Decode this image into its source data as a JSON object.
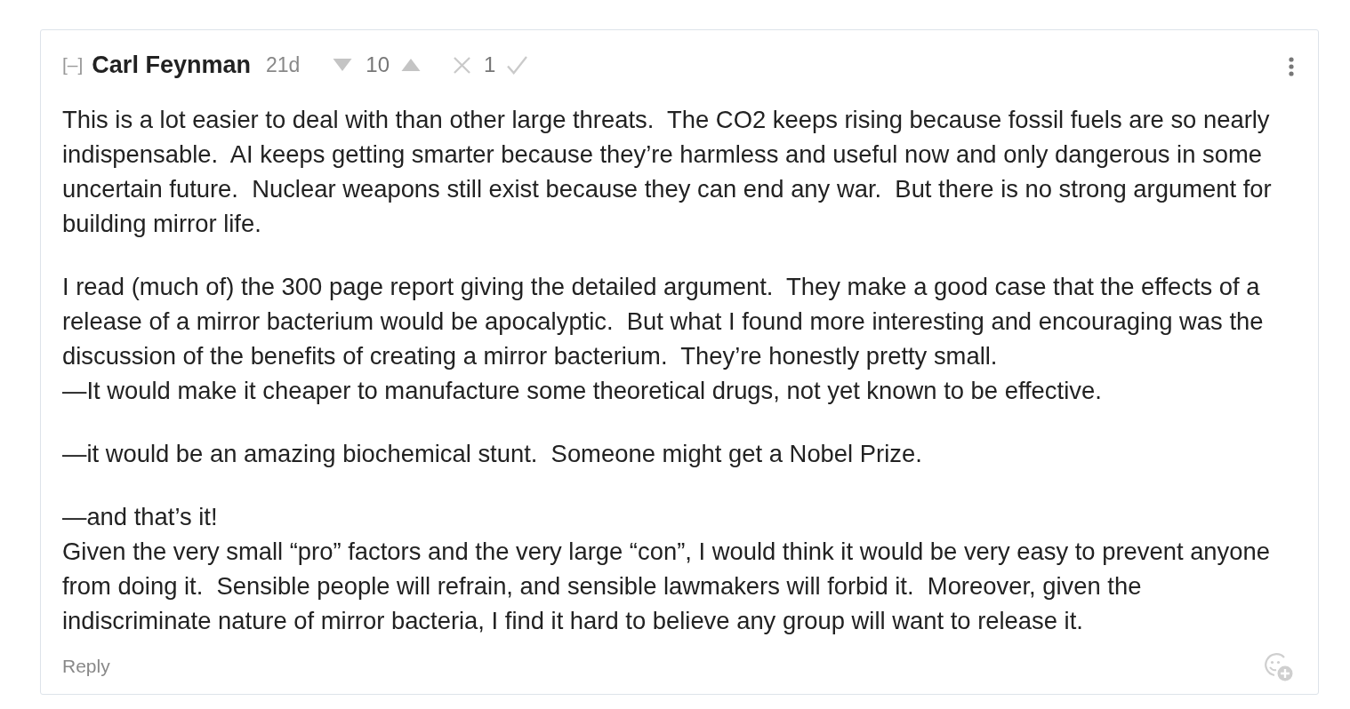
{
  "comment": {
    "collapse_toggle": "[–]",
    "author": "Carl Feynman",
    "age": "21d",
    "karma": {
      "score": "10"
    },
    "agreement": {
      "score": "1"
    },
    "paragraphs": [
      {
        "lines": [
          "This is a lot easier to deal with than other large threats.  The CO2 keeps rising because fossil fuels are so nearly indispensable.  AI keeps getting smarter because they’re harmless and useful now and only dangerous in some uncertain future.  Nuclear weapons still exist because they can end any war.  But there is no strong argument for building mirror life."
        ]
      },
      {
        "lines": [
          "I read (much of) the 300 page report giving the detailed argument.  They make a good case that the effects of a release of a mirror bacterium would be apocalyptic.  But what I found more interesting and encouraging was the discussion of the benefits of creating a mirror bacterium.  They’re honestly pretty small.",
          "—It would make it cheaper to manufacture some theoretical drugs, not yet known to be effective."
        ]
      },
      {
        "lines": [
          "—it would be an amazing biochemical stunt.  Someone might get a Nobel Prize."
        ]
      },
      {
        "lines": [
          "—and that’s it!",
          "Given the very small “pro” factors and the very large “con”, I would think it would be very easy to prevent anyone from doing it.  Sensible people will refrain, and sensible lawmakers will forbid it.  Moreover, given the indiscriminate nature of mirror bacteria, I find it hard to believe any group will want to release it."
        ]
      }
    ],
    "reply_link": "Reply"
  }
}
